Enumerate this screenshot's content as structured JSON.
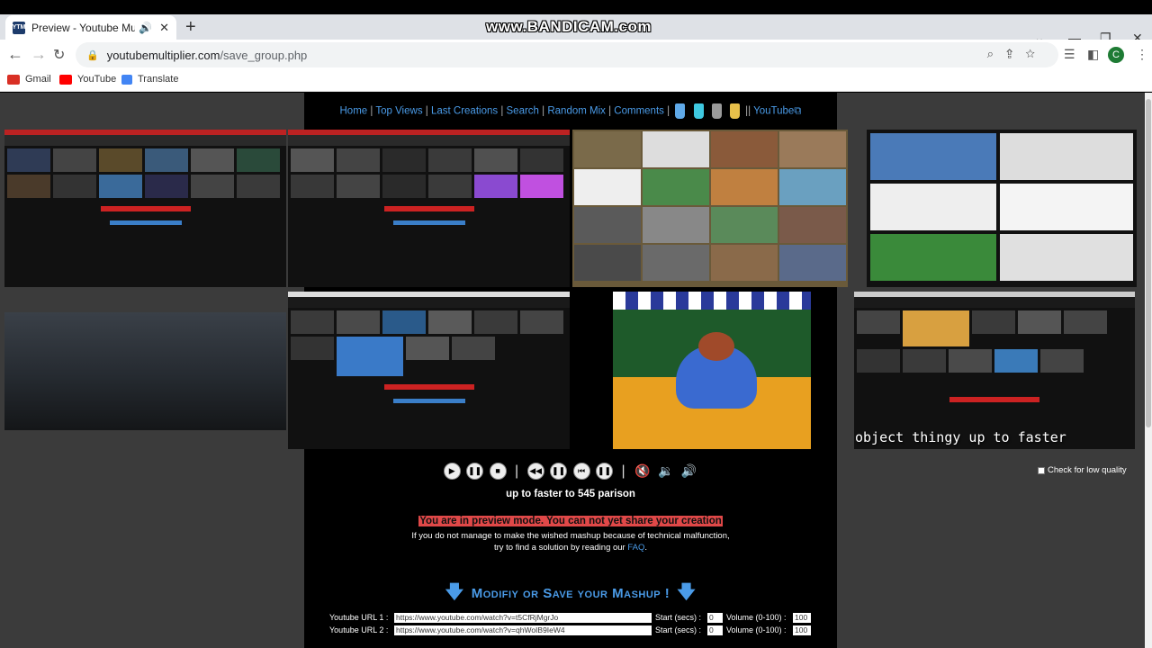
{
  "browser": {
    "tab_title": "Preview - Youtube Multiplier",
    "tab_favicon": "YTM",
    "watermark": "www.BANDICAM.com",
    "url_host": "youtubemultiplier.com",
    "url_path": "/save_group.php",
    "profile_initial": "C",
    "bookmarks": [
      "Gmail",
      "YouTube",
      "Translate"
    ]
  },
  "nav": {
    "links": [
      "Home",
      "Top Views",
      "Last Creations",
      "Search",
      "Random Mix",
      "Comments"
    ],
    "youtube_link": "YouTube",
    "cup_colors": [
      "#5fa9e8",
      "#3ec8e0",
      "#9a9a9a",
      "#e8c04a"
    ]
  },
  "video_overlay_text": "object thingy up to faster",
  "player": {
    "low_quality_label": "Check for low quality",
    "mix_title": "up to faster to 545 parison"
  },
  "preview": {
    "warning": "You are in preview mode. You can not yet share your creation",
    "info_line1": "If you do not manage to make the wished mashup because of technical malfunction,",
    "info_line2_prefix": "try to find a solution by reading our ",
    "faq_link": "FAQ",
    "info_line2_suffix": "."
  },
  "modify": {
    "heading": "Modifiy or Save your Mashup !",
    "rows": [
      {
        "label": "Youtube URL 1 :",
        "url": "https://www.youtube.com/watch?v=t5CfRjMgrJo",
        "start_label": "Start (secs) :",
        "start": "0",
        "volume_label": "Volume (0-100) :",
        "volume": "100"
      },
      {
        "label": "Youtube URL 2 :",
        "url": "https://www.youtube.com/watch?v=qhWoIB9IeW4",
        "start_label": "Start (secs) :",
        "start": "0",
        "volume_label": "Volume (0-100) :",
        "volume": "100"
      }
    ]
  }
}
